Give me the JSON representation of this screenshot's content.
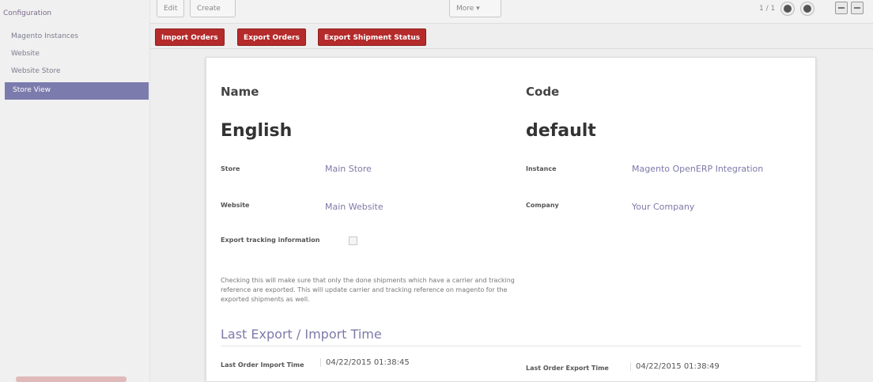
{
  "sidebar": {
    "heading": "Configuration",
    "items": [
      {
        "label": "Magento Instances"
      },
      {
        "label": "Website"
      },
      {
        "label": "Website Store"
      },
      {
        "label": "Store View"
      }
    ]
  },
  "toolbar": {
    "edit_label": "Edit",
    "create_label": "Create",
    "more_label": "More ▾",
    "pager": "1 / 1"
  },
  "actions": {
    "import_orders": "Import Orders",
    "export_orders": "Export Orders",
    "export_shipment_status": "Export Shipment Status"
  },
  "form": {
    "name_label": "Name",
    "name_value": "English",
    "code_label": "Code",
    "code_value": "default",
    "store_label": "Store",
    "store_value": "Main Store",
    "instance_label": "Instance",
    "instance_value": "Magento OpenERP Integration",
    "website_label": "Website",
    "website_value": "Main Website",
    "company_label": "Company",
    "company_value": "Your Company",
    "export_tracking_label": "Export tracking information",
    "export_tracking_checked": false,
    "help_text": "Checking this will make sure that only the done shipments which have a carrier and tracking reference are exported. This will update carrier and tracking reference on magento for the exported shipments as well.",
    "section_title": "Last Export / Import Time",
    "last_import_label": "Last Order Import Time",
    "last_import_value": "04/22/2015 01:38:45",
    "last_export_label": "Last Order Export Time",
    "last_export_value": "04/22/2015 01:38:49"
  },
  "colors": {
    "accent_red": "#b52a2a",
    "active_sidebar": "#7c7bad",
    "link_value": "#7d7aa8"
  }
}
